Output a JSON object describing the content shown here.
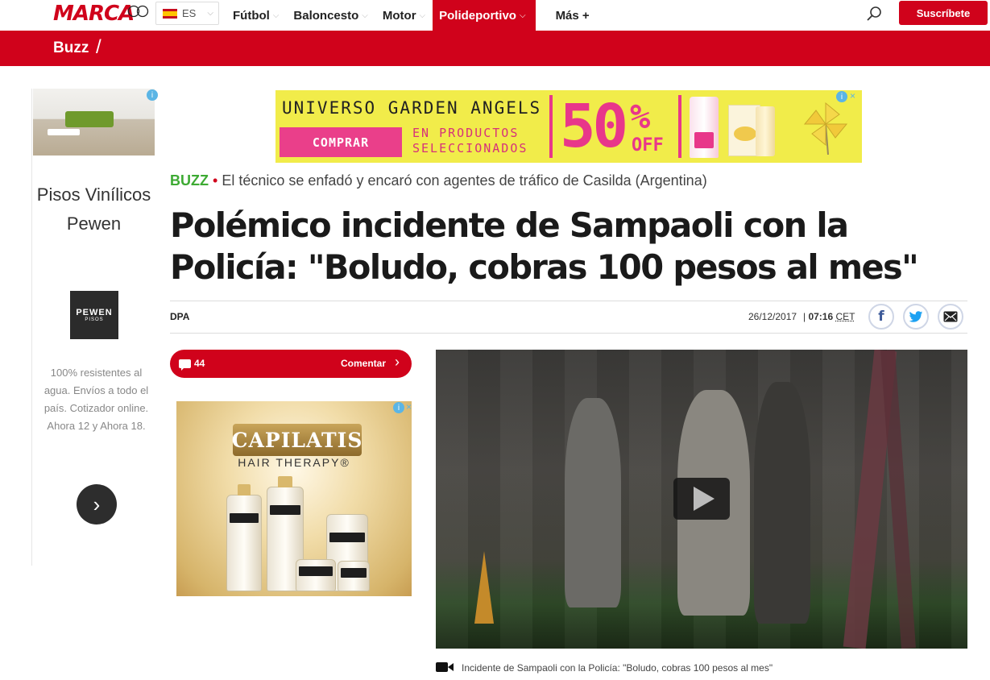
{
  "header": {
    "logo": "MARCA",
    "language": "ES",
    "nav": [
      {
        "label": "Fútbol",
        "chevron": true,
        "active": false
      },
      {
        "label": "Baloncesto",
        "chevron": true,
        "active": false
      },
      {
        "label": "Motor",
        "chevron": true,
        "active": false
      },
      {
        "label": "Polideportivo",
        "chevron": true,
        "active": true
      },
      {
        "label": "Más +",
        "chevron": false,
        "active": false
      }
    ],
    "subscribe_label": "Suscríbete",
    "accent_color": "#d0021b"
  },
  "section": {
    "title": "Buzz",
    "separator": "/"
  },
  "left_ad": {
    "title": "Pisos Vinílicos Pewen",
    "logo_text": "PEWEN",
    "logo_sub": "PISOS",
    "description": "100% resistentes al agua. Envíos a todo el país. Cotizador online. Ahora 12 y Ahora 18.",
    "next_icon": "chevron-right-icon"
  },
  "top_banner": {
    "headline": "UNIVERSO GARDEN ANGELS",
    "cta": "COMPRAR",
    "sub_line1": "EN PRODUCTOS",
    "sub_line2": "SELECCIONADOS",
    "discount": "50",
    "percent": "%",
    "off": "OFF"
  },
  "article": {
    "tag": "BUZZ",
    "bullet": "•",
    "kicker": "El técnico se enfadó y encaró con agentes de tráfico de Casilda (Argentina)",
    "headline": "Polémico incidente de Sampaoli con la Policía: \"Boludo, cobras 100 pesos al mes\"",
    "author": "DPA",
    "date": "26/12/2017",
    "time": "07:16",
    "timezone": "CET",
    "share": [
      "facebook-icon",
      "twitter-icon",
      "email-icon"
    ]
  },
  "comments": {
    "count": "44",
    "cta": "Comentar",
    "arrow": "›"
  },
  "side_ad": {
    "brand": "CAPILATIS",
    "subtitle": "HAIR THERAPY®"
  },
  "video": {
    "caption": "Incidente de Sampaoli con la Policía: \"Boludo, cobras 100 pesos al mes\""
  }
}
